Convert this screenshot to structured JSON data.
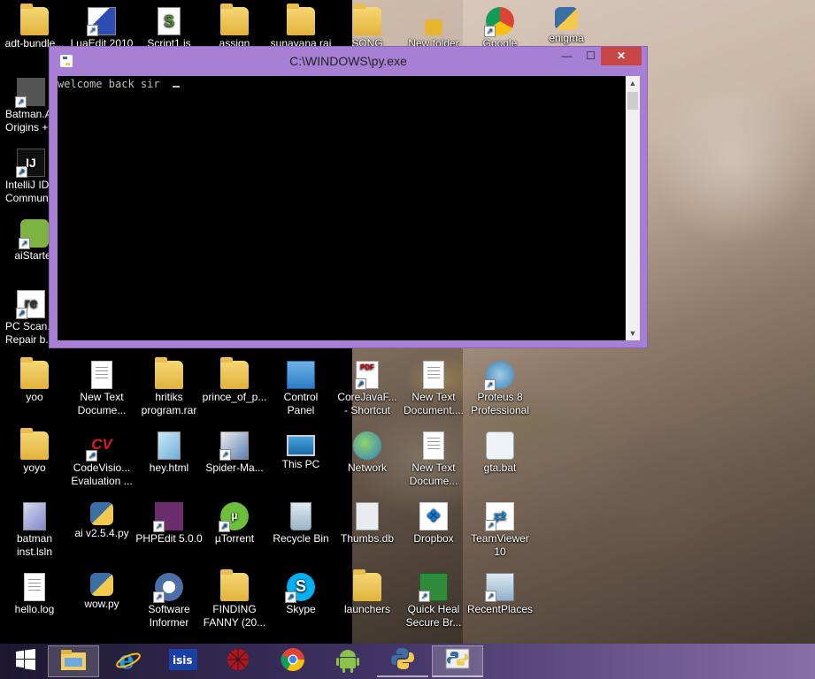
{
  "desktop": {
    "icons": [
      {
        "label": "adt-bundle..."
      },
      {
        "label": "LuaEdit 2010"
      },
      {
        "label": "Script1.js"
      },
      {
        "label": "assign"
      },
      {
        "label": "sunayana rai"
      },
      {
        "label": "SONG"
      },
      {
        "label": "New folder"
      },
      {
        "label": "Google"
      },
      {
        "label": "enigma"
      },
      {
        "label": "Batman.A...\nOrigins +..."
      },
      {
        "label": "IntelliJ ID...\nCommun..."
      },
      {
        "label": "aiStarter"
      },
      {
        "label": "PC Scan...\nRepair b..."
      },
      {
        "label": "yoo"
      },
      {
        "label": "New Text\nDocume..."
      },
      {
        "label": "hritiks\nprogram.rar"
      },
      {
        "label": "prince_of_p..."
      },
      {
        "label": "Control\nPanel"
      },
      {
        "label": "CoreJavaF...\n- Shortcut"
      },
      {
        "label": "New Text\nDocument...."
      },
      {
        "label": "Proteus 8\nProfessional"
      },
      {
        "label": "yoyo"
      },
      {
        "label": "CodeVisio...\nEvaluation ..."
      },
      {
        "label": "hey.html"
      },
      {
        "label": "Spider-Ma..."
      },
      {
        "label": "This PC"
      },
      {
        "label": "Network"
      },
      {
        "label": "New Text\nDocume..."
      },
      {
        "label": "gta.bat"
      },
      {
        "label": "batman\ninst.lsln"
      },
      {
        "label": "ai v2.5.4.py"
      },
      {
        "label": "PHPEdit 5.0.0"
      },
      {
        "label": "µTorrent"
      },
      {
        "label": "Recycle Bin"
      },
      {
        "label": "Thumbs.db"
      },
      {
        "label": "Dropbox"
      },
      {
        "label": "TeamViewer\n10"
      },
      {
        "label": "hello.log"
      },
      {
        "label": "wow.py"
      },
      {
        "label": "Software\nInformer"
      },
      {
        "label": "FINDING\nFANNY (20..."
      },
      {
        "label": "Skype"
      },
      {
        "label": "launchers"
      },
      {
        "label": "Quick Heal\nSecure Br..."
      },
      {
        "label": "RecentPlaces"
      }
    ]
  },
  "console": {
    "title": "C:\\WINDOWS\\py.exe",
    "minimize_glyph": "—",
    "maximize_glyph": "☐",
    "close_glyph": "✕",
    "output": "welcome back sir",
    "scroll_up_glyph": "▲",
    "scroll_down_glyph": "▼"
  },
  "taskbar": {
    "items": [
      {
        "icon": "windows-start-icon"
      },
      {
        "icon": "file-explorer-icon"
      },
      {
        "icon": "internet-explorer-icon"
      },
      {
        "icon": "isis-icon"
      },
      {
        "icon": "spider-man-icon"
      },
      {
        "icon": "chrome-icon"
      },
      {
        "icon": "android-icon"
      },
      {
        "icon": "python-icon"
      },
      {
        "icon": "python-console-icon"
      }
    ]
  },
  "colors": {
    "console_frame": "#a77fd5",
    "close_button": "#c94646",
    "console_text": "#c0c0c0"
  }
}
